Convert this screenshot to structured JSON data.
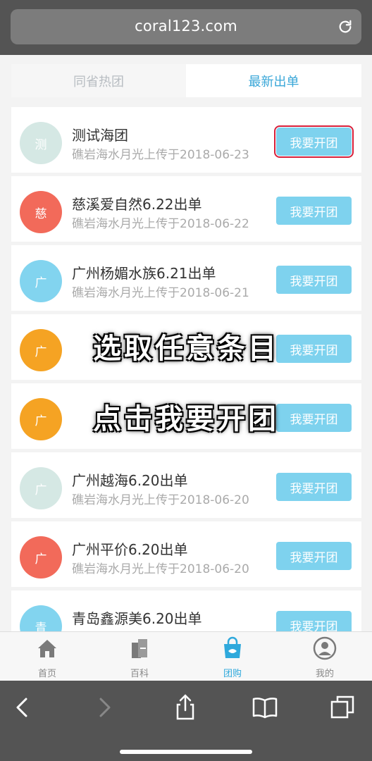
{
  "browser": {
    "url": "coral123.com"
  },
  "tabs": [
    "同省热团",
    "最新出单"
  ],
  "items": [
    {
      "avatar": "测",
      "title": "测试海团",
      "subtitle": "礁岩海水月光上传于2018-06-23",
      "button": "我要开团",
      "color": "#d5e8e4"
    },
    {
      "avatar": "慈",
      "title": "慈溪爱自然6.22出单",
      "subtitle": "礁岩海水月光上传于2018-06-22",
      "button": "我要开团",
      "color": "#f26a5a"
    },
    {
      "avatar": "广",
      "title": "广州杨媚水族6.21出单",
      "subtitle": "礁岩海水月光上传于2018-06-21",
      "button": "我要开团",
      "color": "#82d4ef"
    },
    {
      "avatar": "广",
      "title": "",
      "subtitle": "",
      "button": "我要开团",
      "color": "#f5a323"
    },
    {
      "avatar": "广",
      "title": "",
      "subtitle": "",
      "button": "我要开团",
      "color": "#f5a323"
    },
    {
      "avatar": "广",
      "title": "广州越海6.20出单",
      "subtitle": "礁岩海水月光上传于2018-06-20",
      "button": "我要开团",
      "color": "#d5e8e4"
    },
    {
      "avatar": "广",
      "title": "广州平价6.20出单",
      "subtitle": "礁岩海水月光上传于2018-06-20",
      "button": "我要开团",
      "color": "#f26a5a"
    },
    {
      "avatar": "青",
      "title": "青岛鑫源美6.20出单",
      "subtitle": "",
      "button": "我要开团",
      "color": "#82d4ef"
    }
  ],
  "overlay": {
    "line1": "选取任意条目",
    "line2": "点击我要开团"
  },
  "nav": [
    {
      "label": "首页",
      "icon": "home-icon"
    },
    {
      "label": "百科",
      "icon": "encyclopedia-icon"
    },
    {
      "label": "团购",
      "icon": "group-buy-icon"
    },
    {
      "label": "我的",
      "icon": "profile-icon"
    }
  ],
  "toolbar_icons": [
    "back-icon",
    "forward-icon",
    "share-icon",
    "bookmarks-icon",
    "tabs-icon"
  ]
}
